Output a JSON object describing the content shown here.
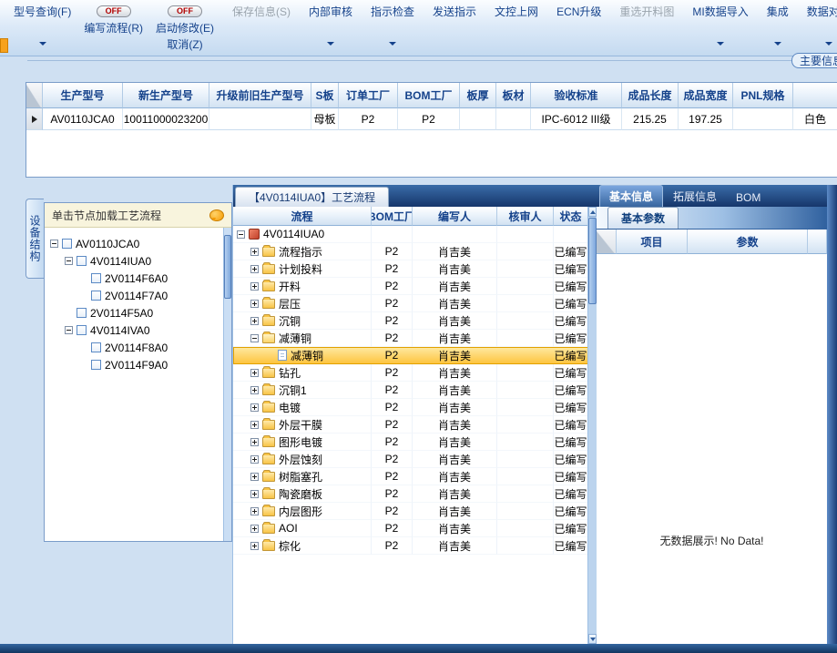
{
  "toolbar": {
    "off_label": "OFF",
    "buttons": [
      {
        "name": "model-query",
        "label": "型号查询(F)",
        "off": false,
        "label2": "",
        "arrow": true,
        "enabled": true,
        "sep": false
      },
      {
        "name": "write-flow",
        "label": "编写流程(R)",
        "off": true,
        "label2": "",
        "arrow": false,
        "enabled": true,
        "sep": false
      },
      {
        "name": "start-modify",
        "label": "启动修改(E)",
        "off": true,
        "label2": "取消(Z)",
        "arrow": false,
        "enabled": true,
        "sep": false
      },
      {
        "name": "save-info",
        "label": "保存信息(S)",
        "off": false,
        "label2": "",
        "arrow": false,
        "enabled": false,
        "sep": true
      },
      {
        "name": "internal-audit",
        "label": "内部审核",
        "off": false,
        "label2": "",
        "arrow": true,
        "enabled": true,
        "sep": true
      },
      {
        "name": "instruction-check",
        "label": "指示检查",
        "off": false,
        "label2": "",
        "arrow": true,
        "enabled": true,
        "sep": true
      },
      {
        "name": "send-instruction",
        "label": "发送指示",
        "off": false,
        "label2": "",
        "arrow": false,
        "enabled": true,
        "sep": true
      },
      {
        "name": "doc-control-upload",
        "label": "文控上网",
        "off": false,
        "label2": "",
        "arrow": false,
        "enabled": true,
        "sep": true
      },
      {
        "name": "ecn-upgrade",
        "label": "ECN升级",
        "off": false,
        "label2": "",
        "arrow": false,
        "enabled": true,
        "sep": true
      },
      {
        "name": "reselect-cutting-plan",
        "label": "重选开料图",
        "off": false,
        "label2": "",
        "arrow": false,
        "enabled": false,
        "sep": true
      },
      {
        "name": "mi-data-import",
        "label": "MI数据导入",
        "off": false,
        "label2": "",
        "arrow": true,
        "enabled": true,
        "sep": true
      },
      {
        "name": "integrate",
        "label": "集成",
        "off": false,
        "label2": "",
        "arrow": true,
        "enabled": true,
        "sep": true
      },
      {
        "name": "data-compare",
        "label": "数据对比",
        "off": false,
        "label2": "",
        "arrow": true,
        "enabled": true,
        "sep": true
      }
    ]
  },
  "group_label": "主要信息",
  "grid": {
    "columns": [
      "生产型号",
      "新生产型号",
      "升级前旧生产型号",
      "S板",
      "订单工厂",
      "BOM工厂",
      "板厚",
      "板材",
      "验收标准",
      "成品长度",
      "成品宽度",
      "PNL规格",
      ""
    ],
    "row": [
      "AV0110JCA0",
      "10011000023200",
      "",
      "母板",
      "P2",
      "P2",
      "",
      "",
      "IPC-6012 III级",
      "215.25",
      "197.25",
      "",
      "白色"
    ]
  },
  "left": {
    "vertical_tab": "设备结构",
    "hint": "单击节点加载工艺流程",
    "tree": [
      {
        "label": "AV0110JCA0",
        "level": 0,
        "expander": "-"
      },
      {
        "label": "4V0114IUA0",
        "level": 1,
        "expander": "-"
      },
      {
        "label": "2V0114F6A0",
        "level": 2,
        "expander": ""
      },
      {
        "label": "2V0114F7A0",
        "level": 2,
        "expander": ""
      },
      {
        "label": "2V0114F5A0",
        "level": 1,
        "expander": ""
      },
      {
        "label": "4V0114IVA0",
        "level": 1,
        "expander": "-"
      },
      {
        "label": "2V0114F8A0",
        "level": 2,
        "expander": ""
      },
      {
        "label": "2V0114F9A0",
        "level": 2,
        "expander": ""
      }
    ]
  },
  "flow": {
    "title": "【4V0114IUA0】工艺流程",
    "columns": [
      "流程",
      "BOM工厂",
      "编写人",
      "核审人",
      "状态"
    ],
    "rows": [
      {
        "name": "4V0114IUA0",
        "level": 0,
        "expander": "-",
        "icon": "root",
        "bom": "",
        "writer": "",
        "auditor": "",
        "status": "",
        "selected": false
      },
      {
        "name": "流程指示",
        "level": 1,
        "expander": "+",
        "icon": "folder",
        "bom": "P2",
        "writer": "肖吉美",
        "auditor": "",
        "status": "已编写",
        "selected": false
      },
      {
        "name": "计划投料",
        "level": 1,
        "expander": "+",
        "icon": "folder",
        "bom": "P2",
        "writer": "肖吉美",
        "auditor": "",
        "status": "已编写",
        "selected": false
      },
      {
        "name": "开料",
        "level": 1,
        "expander": "+",
        "icon": "folder",
        "bom": "P2",
        "writer": "肖吉美",
        "auditor": "",
        "status": "已编写",
        "selected": false
      },
      {
        "name": "层压",
        "level": 1,
        "expander": "+",
        "icon": "folder",
        "bom": "P2",
        "writer": "肖吉美",
        "auditor": "",
        "status": "已编写",
        "selected": false
      },
      {
        "name": "沉铜",
        "level": 1,
        "expander": "+",
        "icon": "folder",
        "bom": "P2",
        "writer": "肖吉美",
        "auditor": "",
        "status": "已编写",
        "selected": false
      },
      {
        "name": "减薄铜",
        "level": 1,
        "expander": "-",
        "icon": "folder-open",
        "bom": "P2",
        "writer": "肖吉美",
        "auditor": "",
        "status": "已编写",
        "selected": false
      },
      {
        "name": "减薄铜",
        "level": 2,
        "expander": "",
        "icon": "doc",
        "bom": "P2",
        "writer": "肖吉美",
        "auditor": "",
        "status": "已编写",
        "selected": true
      },
      {
        "name": "钻孔",
        "level": 1,
        "expander": "+",
        "icon": "folder",
        "bom": "P2",
        "writer": "肖吉美",
        "auditor": "",
        "status": "已编写",
        "selected": false
      },
      {
        "name": "沉铜1",
        "level": 1,
        "expander": "+",
        "icon": "folder",
        "bom": "P2",
        "writer": "肖吉美",
        "auditor": "",
        "status": "已编写",
        "selected": false
      },
      {
        "name": "电镀",
        "level": 1,
        "expander": "+",
        "icon": "folder",
        "bom": "P2",
        "writer": "肖吉美",
        "auditor": "",
        "status": "已编写",
        "selected": false
      },
      {
        "name": "外层干膜",
        "level": 1,
        "expander": "+",
        "icon": "folder",
        "bom": "P2",
        "writer": "肖吉美",
        "auditor": "",
        "status": "已编写",
        "selected": false
      },
      {
        "name": "图形电镀",
        "level": 1,
        "expander": "+",
        "icon": "folder",
        "bom": "P2",
        "writer": "肖吉美",
        "auditor": "",
        "status": "已编写",
        "selected": false
      },
      {
        "name": "外层蚀刻",
        "level": 1,
        "expander": "+",
        "icon": "folder",
        "bom": "P2",
        "writer": "肖吉美",
        "auditor": "",
        "status": "已编写",
        "selected": false
      },
      {
        "name": "树脂塞孔",
        "level": 1,
        "expander": "+",
        "icon": "folder",
        "bom": "P2",
        "writer": "肖吉美",
        "auditor": "",
        "status": "已编写",
        "selected": false
      },
      {
        "name": "陶瓷磨板",
        "level": 1,
        "expander": "+",
        "icon": "folder",
        "bom": "P2",
        "writer": "肖吉美",
        "auditor": "",
        "status": "已编写",
        "selected": false
      },
      {
        "name": "内层图形",
        "level": 1,
        "expander": "+",
        "icon": "folder",
        "bom": "P2",
        "writer": "肖吉美",
        "auditor": "",
        "status": "已编写",
        "selected": false
      },
      {
        "name": "AOI",
        "level": 1,
        "expander": "+",
        "icon": "folder",
        "bom": "P2",
        "writer": "肖吉美",
        "auditor": "",
        "status": "已编写",
        "selected": false
      },
      {
        "name": "棕化",
        "level": 1,
        "expander": "+",
        "icon": "folder",
        "bom": "P2",
        "writer": "肖吉美",
        "auditor": "",
        "status": "已编写",
        "selected": false
      }
    ]
  },
  "right": {
    "tabs": [
      {
        "name": "basic-info",
        "label": "基本信息",
        "selected": true
      },
      {
        "name": "extended-info",
        "label": "拓展信息",
        "selected": false
      },
      {
        "name": "bom",
        "label": "BOM",
        "selected": false
      }
    ],
    "subtab": "基本参数",
    "columns": [
      "项目",
      "参数"
    ],
    "no_data": "无数据展示! No Data!"
  }
}
